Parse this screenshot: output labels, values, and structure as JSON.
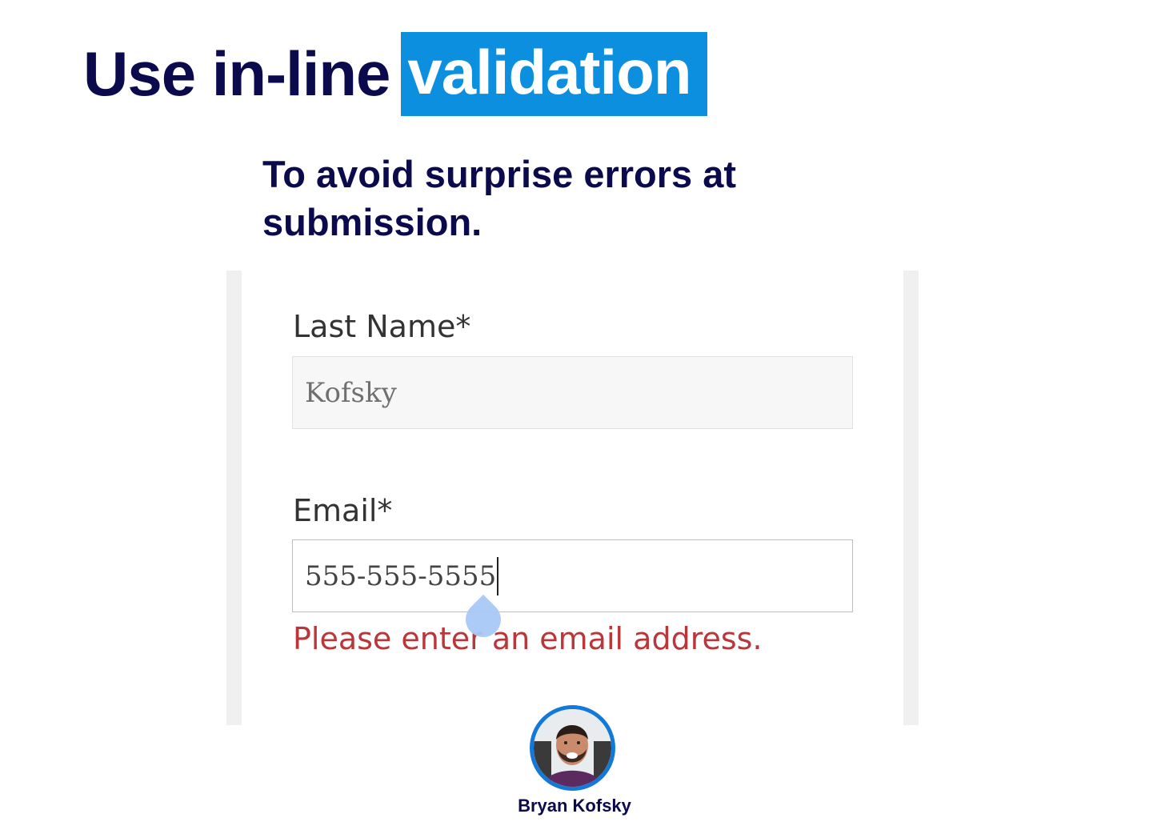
{
  "slide": {
    "title_plain": "Use in-line",
    "title_highlight": "validation",
    "subtitle": "To avoid surprise errors at submission."
  },
  "form": {
    "last_name_label": "Last Name*",
    "last_name_value": "Kofsky",
    "email_label": "Email*",
    "email_value": "555-555-5555",
    "email_error": "Please enter an email address."
  },
  "presenter": {
    "name": "Bryan Kofsky"
  },
  "colors": {
    "title_text": "#0a0a4d",
    "highlight_bg": "#0d8fe0",
    "error_text": "#b9373a",
    "avatar_ring": "#1478d9"
  }
}
